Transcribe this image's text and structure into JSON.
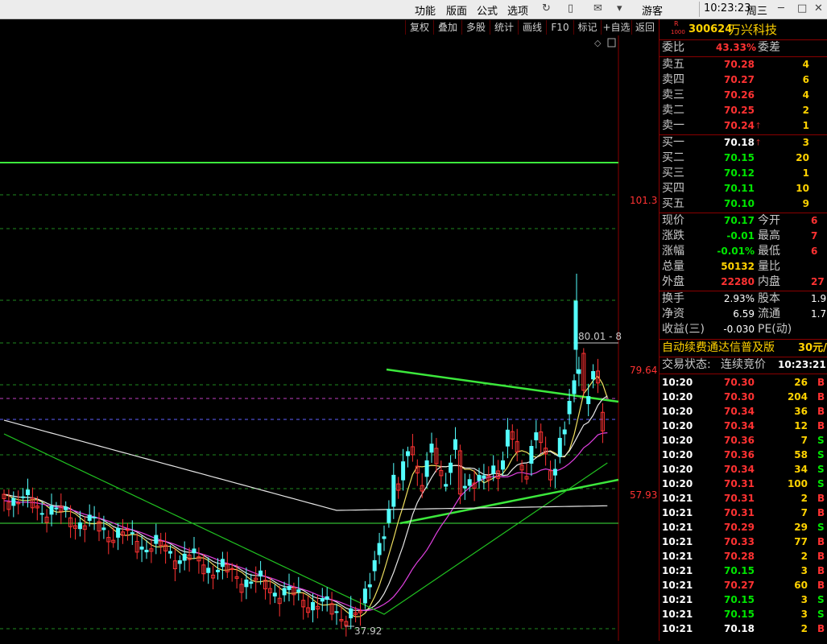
{
  "menu": {
    "items": [
      "功能",
      "版面",
      "公式",
      "选项"
    ],
    "user": "游客",
    "time": "10:23:23",
    "weekday": "周三"
  },
  "toolbar": {
    "buttons": [
      "复权",
      "叠加",
      "多股",
      "统计",
      "画线",
      "F10",
      "标记",
      "+自选",
      "返回"
    ]
  },
  "stock": {
    "code": "300624",
    "name": "万兴科技",
    "badge_r": "R",
    "badge_sub": "1000"
  },
  "weibi": {
    "label": "委比",
    "value": "43.33%",
    "label2": "委差"
  },
  "sells": [
    {
      "label": "卖五",
      "price": "70.28",
      "vol": "4"
    },
    {
      "label": "卖四",
      "price": "70.27",
      "vol": "6"
    },
    {
      "label": "卖三",
      "price": "70.26",
      "vol": "4"
    },
    {
      "label": "卖二",
      "price": "70.25",
      "vol": "2"
    },
    {
      "label": "卖一",
      "price": "70.24",
      "vol": "1",
      "arrow": "🡑"
    }
  ],
  "buys": [
    {
      "label": "买一",
      "price": "70.18",
      "vol": "3",
      "arrow": "🡑"
    },
    {
      "label": "买二",
      "price": "70.15",
      "vol": "20"
    },
    {
      "label": "买三",
      "price": "70.12",
      "vol": "1"
    },
    {
      "label": "买四",
      "price": "70.11",
      "vol": "10"
    },
    {
      "label": "买五",
      "price": "70.10",
      "vol": "9"
    }
  ],
  "quote": [
    {
      "l1": "现价",
      "v1": "70.17",
      "c1": "green",
      "l2": "今开",
      "v2": "6"
    },
    {
      "l1": "涨跌",
      "v1": "-0.01",
      "c1": "green",
      "l2": "最高",
      "v2": "7"
    },
    {
      "l1": "涨幅",
      "v1": "-0.01%",
      "c1": "green",
      "l2": "最低",
      "v2": "6"
    },
    {
      "l1": "总量",
      "v1": "50132",
      "c1": "yellow",
      "l2": "量比",
      "v2": ""
    },
    {
      "l1": "外盘",
      "v1": "22280",
      "c1": "red",
      "l2": "内盘",
      "v2": "27"
    }
  ],
  "fund": [
    {
      "l1": "换手",
      "v1": "2.93%",
      "l2": "股本",
      "v2": "1.9"
    },
    {
      "l1": "净资",
      "v1": "6.59",
      "l2": "流通",
      "v2": "1.7"
    },
    {
      "l1": "收益(三)",
      "v1": "-0.030",
      "l2": "PE(动)",
      "v2": ""
    }
  ],
  "ad": {
    "text": "自动续费通达信普及版",
    "price": "30元/"
  },
  "status": {
    "label": "交易状态:",
    "value": "连续竞价",
    "time": "10:23:21"
  },
  "trades": [
    {
      "t": "10:20",
      "p": "70.30",
      "pc": "red",
      "v": "26",
      "s": "B"
    },
    {
      "t": "10:20",
      "p": "70.30",
      "pc": "red",
      "v": "204",
      "s": "B"
    },
    {
      "t": "10:20",
      "p": "70.34",
      "pc": "red",
      "v": "36",
      "s": "B"
    },
    {
      "t": "10:20",
      "p": "70.34",
      "pc": "red",
      "v": "12",
      "s": "B"
    },
    {
      "t": "10:20",
      "p": "70.36",
      "pc": "red",
      "v": "7",
      "s": "S"
    },
    {
      "t": "10:20",
      "p": "70.36",
      "pc": "red",
      "v": "58",
      "s": "S"
    },
    {
      "t": "10:20",
      "p": "70.34",
      "pc": "red",
      "v": "34",
      "s": "S"
    },
    {
      "t": "10:20",
      "p": "70.31",
      "pc": "red",
      "v": "100",
      "s": "S"
    },
    {
      "t": "10:21",
      "p": "70.31",
      "pc": "red",
      "v": "2",
      "s": "B"
    },
    {
      "t": "10:21",
      "p": "70.31",
      "pc": "red",
      "v": "7",
      "s": "B"
    },
    {
      "t": "10:21",
      "p": "70.29",
      "pc": "red",
      "v": "29",
      "s": "S"
    },
    {
      "t": "10:21",
      "p": "70.33",
      "pc": "red",
      "v": "77",
      "s": "B"
    },
    {
      "t": "10:21",
      "p": "70.28",
      "pc": "red",
      "v": "2",
      "s": "B"
    },
    {
      "t": "10:21",
      "p": "70.15",
      "pc": "green",
      "v": "3",
      "s": "B"
    },
    {
      "t": "10:21",
      "p": "70.27",
      "pc": "red",
      "v": "60",
      "s": "B"
    },
    {
      "t": "10:21",
      "p": "70.15",
      "pc": "green",
      "v": "3",
      "s": "S"
    },
    {
      "t": "10:21",
      "p": "70.15",
      "pc": "green",
      "v": "3",
      "s": "S"
    },
    {
      "t": "10:21",
      "p": "70.18",
      "pc": "white",
      "v": "2",
      "s": "B"
    }
  ],
  "chart_data": {
    "type": "candlestick",
    "price_labels": [
      "101.3",
      "79.64",
      "57.93"
    ],
    "low_label": "37.92",
    "high_label": "80.01 - 8",
    "ylim": [
      36,
      110
    ]
  },
  "colors": {
    "up": "#ff3232",
    "down": "#54ffff",
    "green_line": "#3ce83c",
    "ma_white": "#e6e6e6",
    "ma_yellow": "#f0e060",
    "ma_magenta": "#e040e0",
    "ma_green": "#20c020"
  }
}
